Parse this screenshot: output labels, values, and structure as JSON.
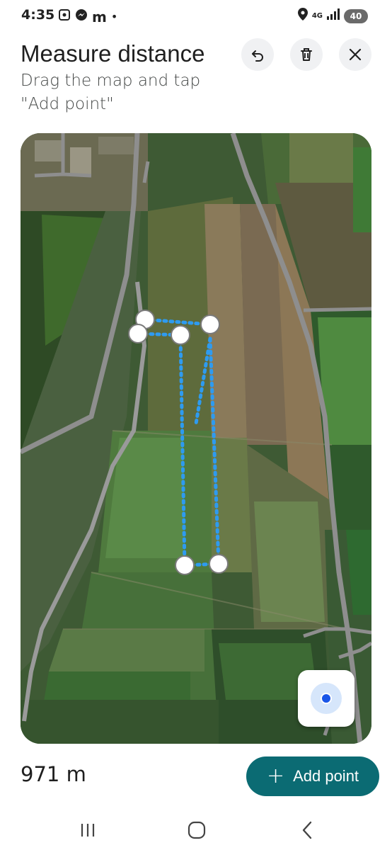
{
  "status_bar": {
    "time": "4:35",
    "carrier_letter": "m",
    "dot": "•",
    "network": "4G",
    "battery": "40",
    "icons": [
      "screenshot-icon",
      "messenger-icon",
      "location-icon",
      "signal-icon"
    ]
  },
  "header": {
    "title": "Measure distance",
    "subtitle": "Drag the map and tap \"Add point\"",
    "buttons": [
      "undo-icon",
      "delete-icon",
      "close-icon"
    ]
  },
  "map": {
    "type": "satellite",
    "measure_line_color": "#2e9bf0",
    "point_count": 6
  },
  "bottom": {
    "distance": "971 m",
    "add_button_plus": "+",
    "add_button_label": "Add point",
    "accent": "#0b6b73"
  },
  "nav_bar": {
    "buttons": [
      "recent-apps-icon",
      "home-icon",
      "back-icon"
    ]
  }
}
